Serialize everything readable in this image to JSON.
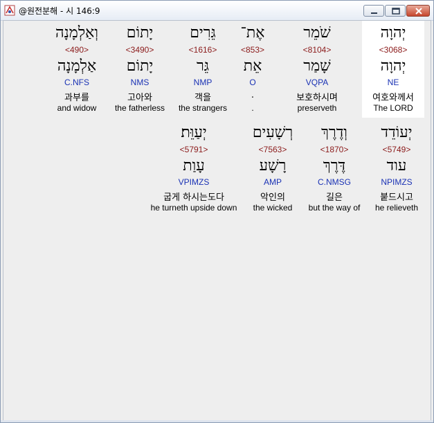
{
  "window": {
    "title": "@원전분해 - 시 146:9",
    "colors": {
      "strong_number": "#8b1a1a",
      "morph_code": "#1a32b4",
      "highlight": "#ffffff",
      "background": "#eeeeee"
    }
  },
  "row1": [
    {
      "hebrew": "יְהוָה",
      "strong": "<3068>",
      "lemma": "יְהוָה",
      "code": "NE",
      "korean": "여호와께서",
      "english": "The LORD"
    },
    {
      "hebrew": "שֹׁמֵר",
      "strong": "<8104>",
      "lemma": "שָׁמַר",
      "code": "VQPA",
      "korean": "보호하시며",
      "english": "preserveth"
    },
    {
      "hebrew": "אֶת־",
      "strong": "<853>",
      "lemma": "אֵת",
      "code": "O",
      "korean": ".",
      "english": "."
    },
    {
      "hebrew": "גֵּרִים",
      "strong": "<1616>",
      "lemma": "גֵּר",
      "code": "NMP",
      "korean": "객을",
      "english": "the strangers"
    },
    {
      "hebrew": "יָתוֹם",
      "strong": "<3490>",
      "lemma": "יָתוֹם",
      "code": "NMS",
      "korean": "고아와",
      "english": "the fatherless"
    },
    {
      "hebrew": "וְאַלְמָנָה",
      "strong": "<490>",
      "lemma": "אַלְמָנָה",
      "code": "C.NFS",
      "korean": "과부를",
      "english": "and widow"
    }
  ],
  "row2": [
    {
      "hebrew": "יְעוֹדֵד",
      "strong": "<5749>",
      "lemma": "עוד",
      "code": "NPIMZS",
      "korean": "붙드시고",
      "english": "he relieveth"
    },
    {
      "hebrew": "וְדֶרֶךְ",
      "strong": "<1870>",
      "lemma": "דֶּרֶךְ",
      "code": "C.NMSG",
      "korean": "길은",
      "english": "but the way of"
    },
    {
      "hebrew": "רְשָׁעִים",
      "strong": "<7563>",
      "lemma": "רָשָׁע",
      "code": "AMP",
      "korean": "악인의",
      "english": "the wicked"
    },
    {
      "hebrew": "יְעַוֵּת׃",
      "strong": "<5791>",
      "lemma": "עָוַת",
      "code": "VPIMZS",
      "korean": "굽게 하시는도다",
      "english": "he turneth upside down"
    }
  ]
}
